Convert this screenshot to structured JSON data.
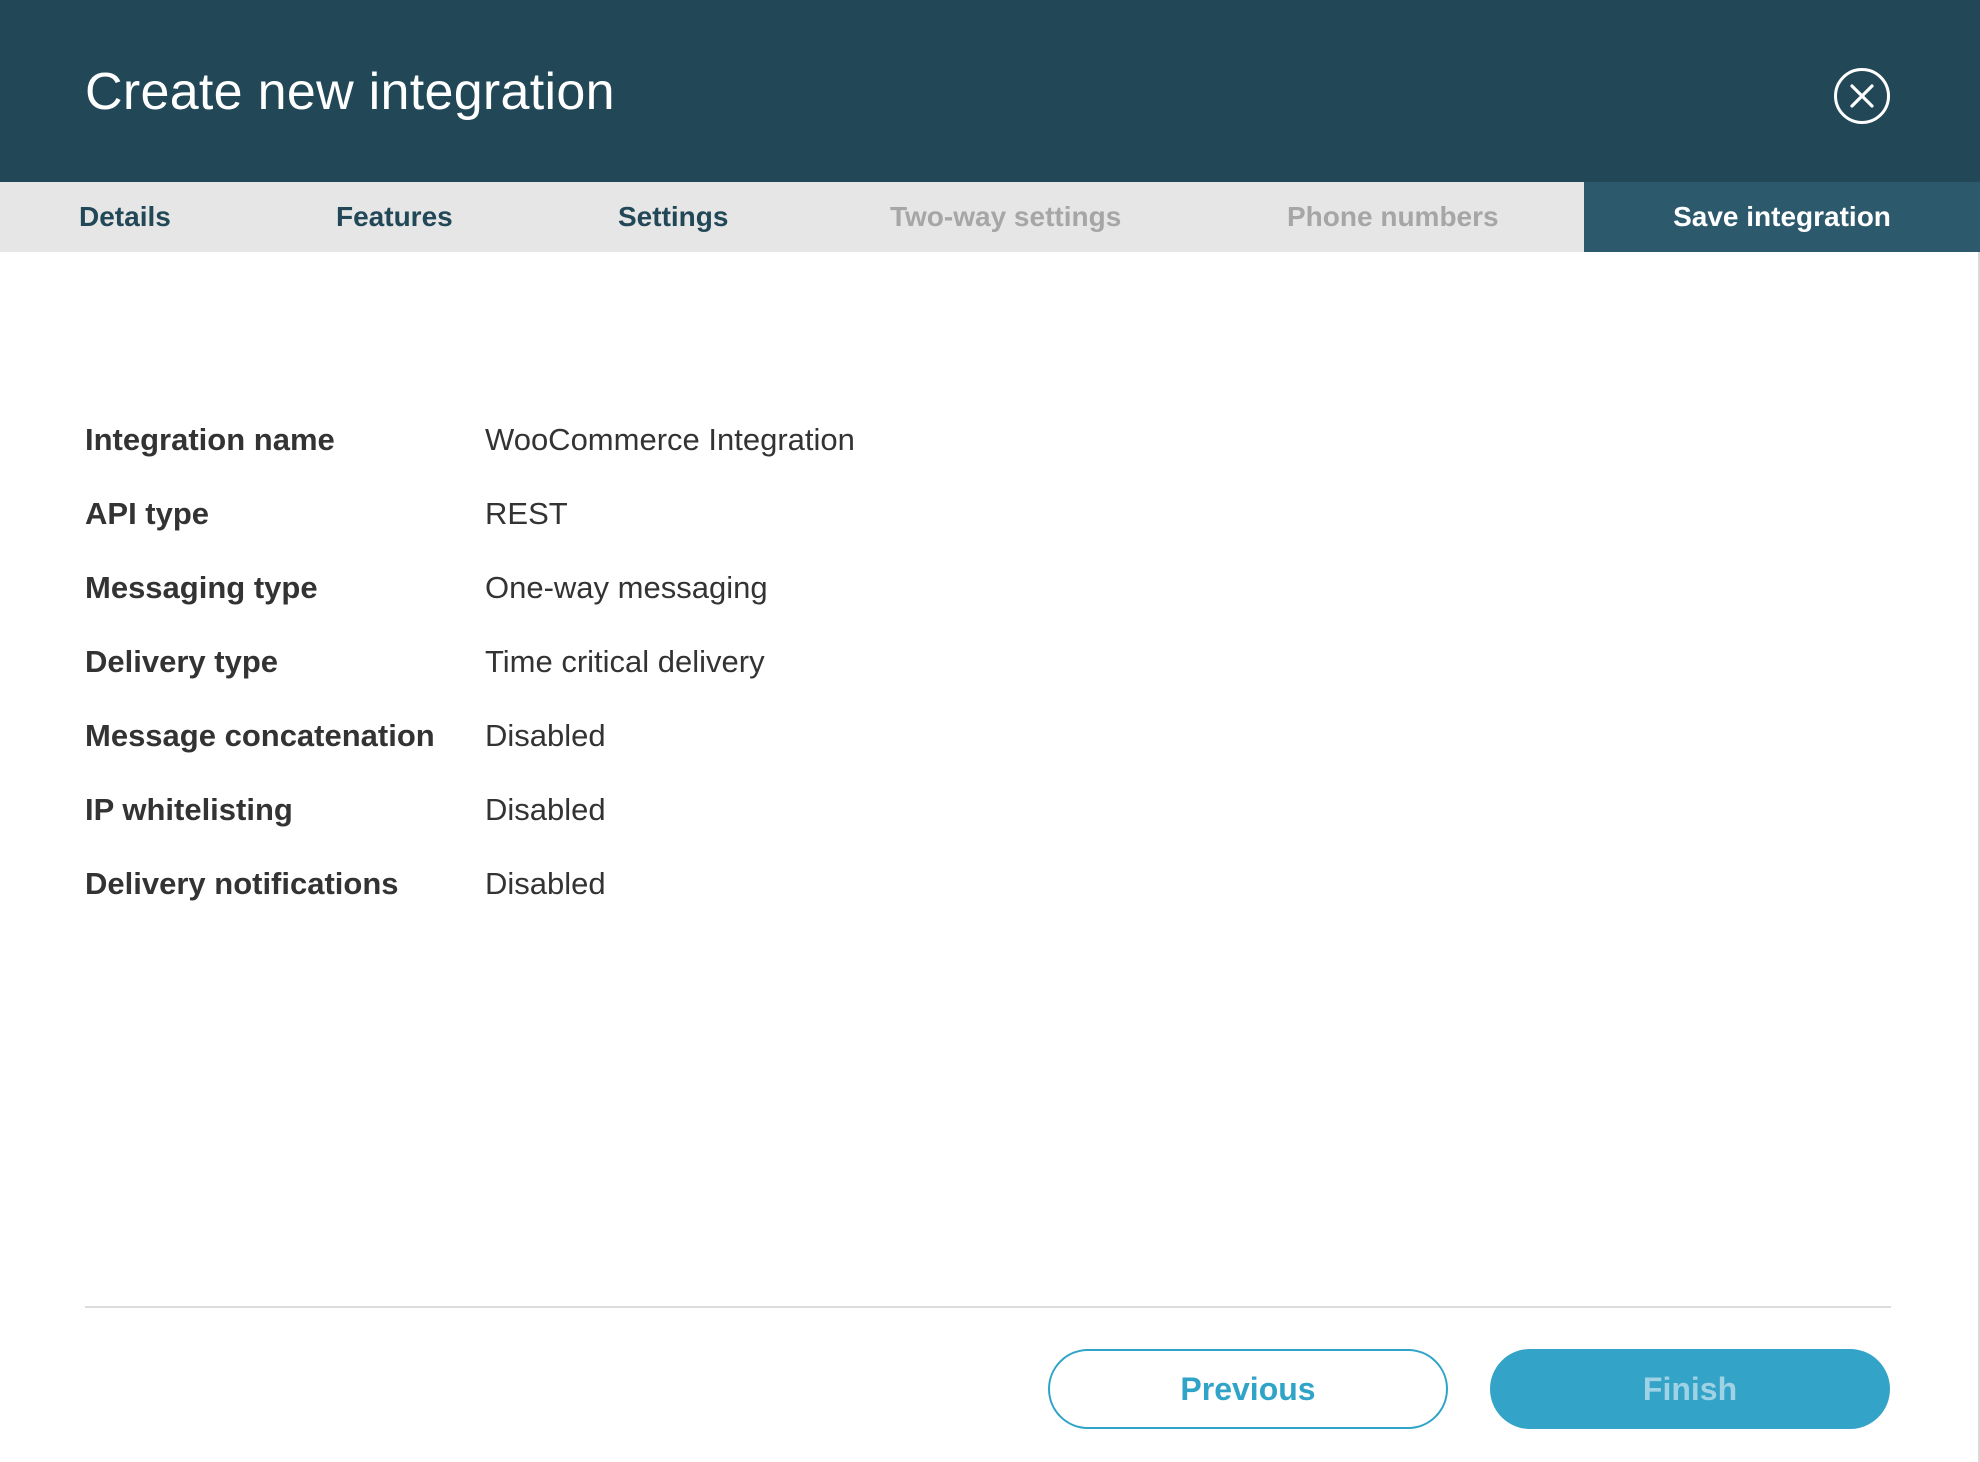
{
  "header": {
    "title": "Create new integration",
    "close_icon": "close-circle-icon"
  },
  "tabs": [
    {
      "label": "Details",
      "state": "complete"
    },
    {
      "label": "Features",
      "state": "complete"
    },
    {
      "label": "Settings",
      "state": "complete"
    },
    {
      "label": "Two-way settings",
      "state": "disabled"
    },
    {
      "label": "Phone numbers",
      "state": "disabled"
    },
    {
      "label": "Save integration",
      "state": "active"
    }
  ],
  "summary": [
    {
      "label": "Integration name",
      "value": "WooCommerce Integration"
    },
    {
      "label": "API type",
      "value": "REST"
    },
    {
      "label": "Messaging type",
      "value": "One-way messaging"
    },
    {
      "label": "Delivery type",
      "value": "Time critical delivery"
    },
    {
      "label": "Message concatenation",
      "value": "Disabled"
    },
    {
      "label": "IP whitelisting",
      "value": "Disabled"
    },
    {
      "label": "Delivery notifications",
      "value": "Disabled"
    }
  ],
  "footer": {
    "previous_label": "Previous",
    "finish_label": "Finish"
  },
  "colors": {
    "header_bg": "#224858",
    "active_tab_bg": "#2c5a6c",
    "accent": "#34a3c8"
  }
}
